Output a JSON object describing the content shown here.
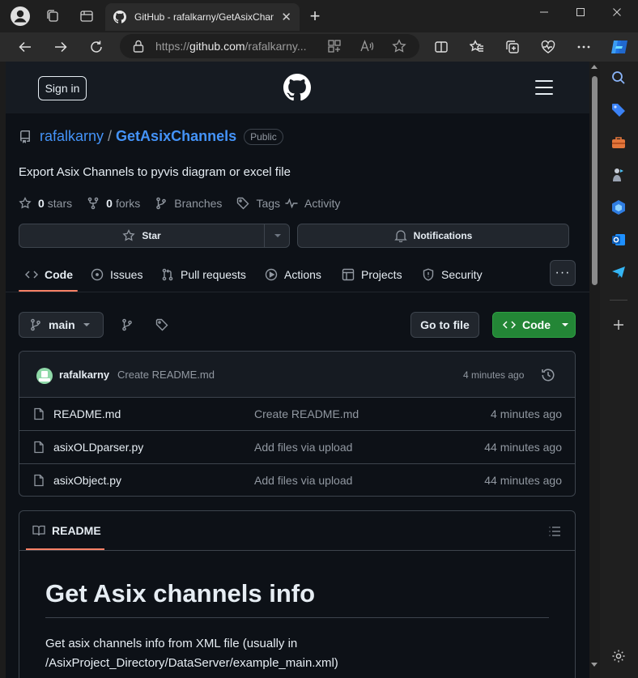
{
  "browser": {
    "tab_title": "GitHub - rafalkarny/GetAsixChan",
    "address_prefix": "https://",
    "address_host": "github.com",
    "address_rest": "/rafalkarny...",
    "colors": {
      "frame": "#1f1f1f",
      "toolbar": "#2b2b2b"
    }
  },
  "header": {
    "sign_in_label": "Sign in"
  },
  "repo": {
    "owner": "rafalkarny",
    "separator": "/",
    "name": "GetAsixChannels",
    "visibility": "Public",
    "description": "Export Asix Channels to pyvis diagram or excel file",
    "stars_count": "0",
    "stars_label": "stars",
    "forks_count": "0",
    "forks_label": "forks",
    "branches_label": "Branches",
    "tags_label": "Tags",
    "activity_label": "Activity",
    "star_button": "Star",
    "notifications_button": "Notifications"
  },
  "tabs": [
    {
      "label": "Code",
      "icon": "code-icon",
      "active": true
    },
    {
      "label": "Issues",
      "icon": "issue-icon"
    },
    {
      "label": "Pull requests",
      "icon": "pull-request-icon"
    },
    {
      "label": "Actions",
      "icon": "play-icon"
    },
    {
      "label": "Projects",
      "icon": "table-icon"
    },
    {
      "label": "Security",
      "icon": "shield-icon"
    }
  ],
  "more_label": "···",
  "branch": {
    "current": "main",
    "go_to_file": "Go to file",
    "code_button": "Code"
  },
  "commit": {
    "author": "rafalkarny",
    "message": "Create README.md",
    "time": "4 minutes ago"
  },
  "files": [
    {
      "name": "README.md",
      "message": "Create README.md",
      "time": "4 minutes ago"
    },
    {
      "name": "asixOLDparser.py",
      "message": "Add files via upload",
      "time": "44 minutes ago"
    },
    {
      "name": "asixObject.py",
      "message": "Add files via upload",
      "time": "44 minutes ago"
    }
  ],
  "readme": {
    "tab_label": "README",
    "heading": "Get Asix channels info",
    "paragraph": "Get asix channels info from XML file (usually in /AsixProject_Directory/DataServer/example_main.xml)"
  },
  "theme": {
    "accent_link": "#4493f8",
    "tab_underline": "#f78166",
    "code_button_bg": "#238636",
    "page_bg": "#0d1117"
  }
}
